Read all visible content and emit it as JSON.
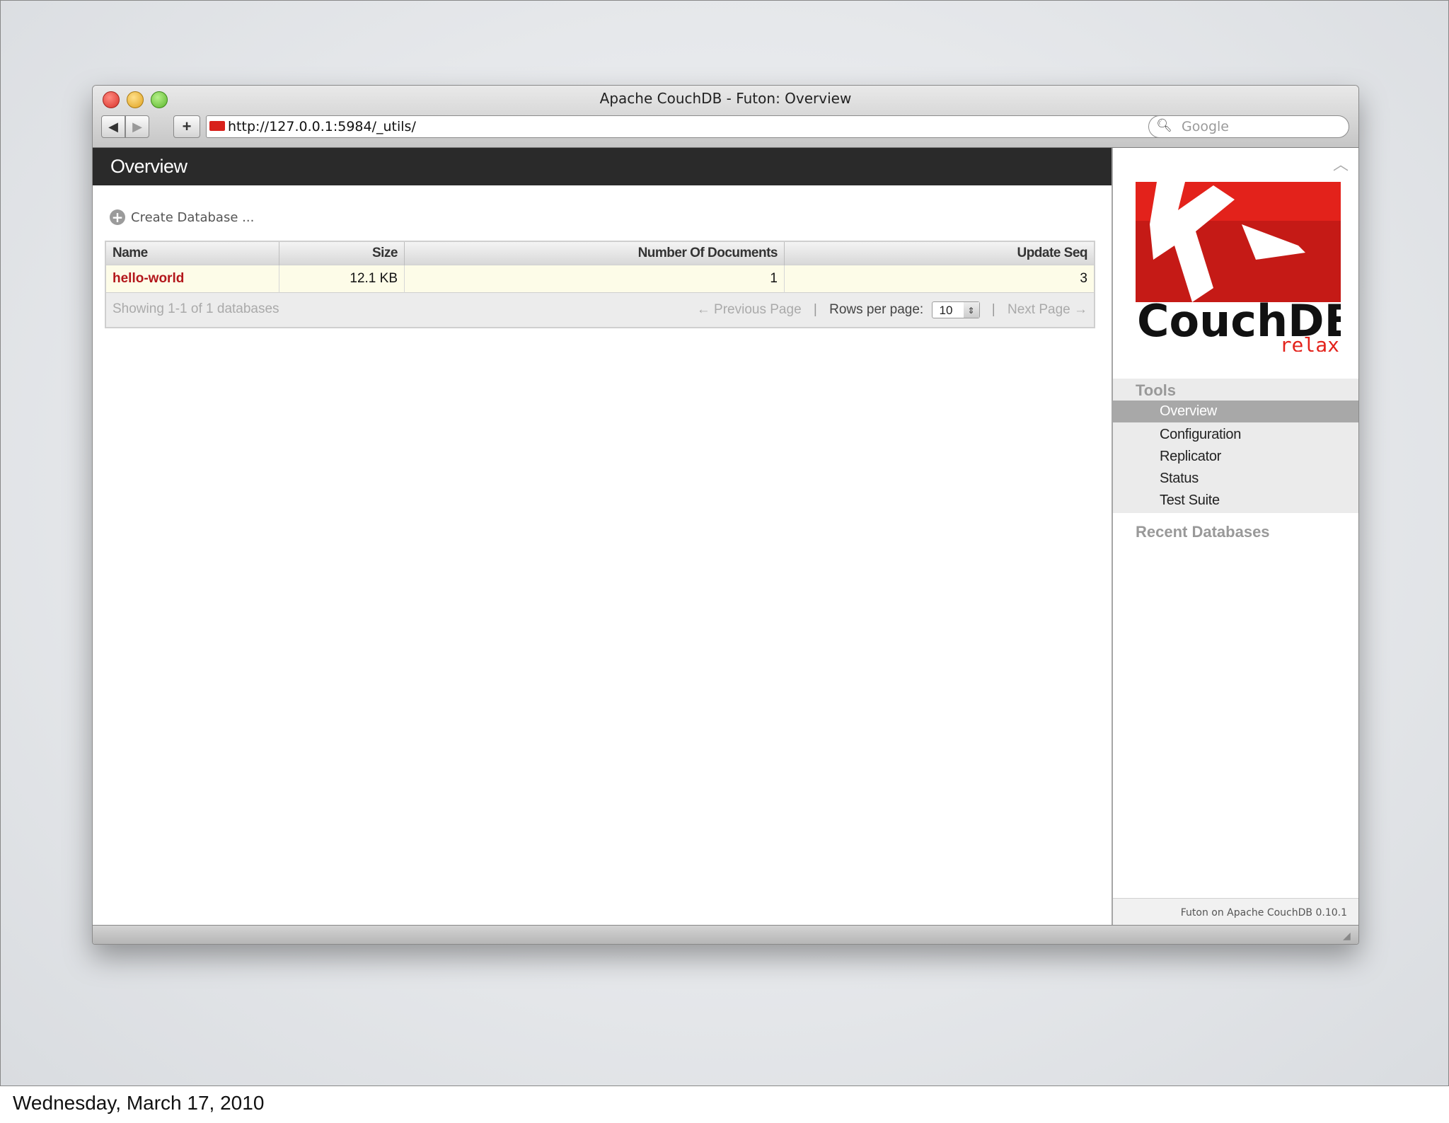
{
  "window": {
    "title": "Apache CouchDB - Futon: Overview",
    "url": "http://127.0.0.1:5984/_utils/",
    "search_placeholder": "Google"
  },
  "page": {
    "header": "Overview",
    "create_database": "Create Database ...",
    "table": {
      "columns": [
        "Name",
        "Size",
        "Number Of Documents",
        "Update Seq"
      ],
      "rows": [
        {
          "name": "hello-world",
          "size": "12.1 KB",
          "docs": "1",
          "update_seq": "3"
        }
      ],
      "footer": {
        "showing": "Showing 1-1 of 1 databases",
        "previous": "← Previous Page",
        "rows_per_page_label": "Rows per page:",
        "rows_per_page_value": "10",
        "next": "Next Page →"
      }
    }
  },
  "sidebar": {
    "logo_text": "CouchDB",
    "logo_tagline": "relax",
    "tools_title": "Tools",
    "tools": [
      "Overview",
      "Configuration",
      "Replicator",
      "Status",
      "Test Suite"
    ],
    "recent_title": "Recent Databases",
    "footer": "Futon on Apache CouchDB 0.10.1"
  },
  "slide_footer": "Wednesday, March 17, 2010",
  "colors": {
    "accent_red": "#d8211b",
    "header_bg": "#2a2a2a",
    "row_bg": "#fdfce8"
  }
}
